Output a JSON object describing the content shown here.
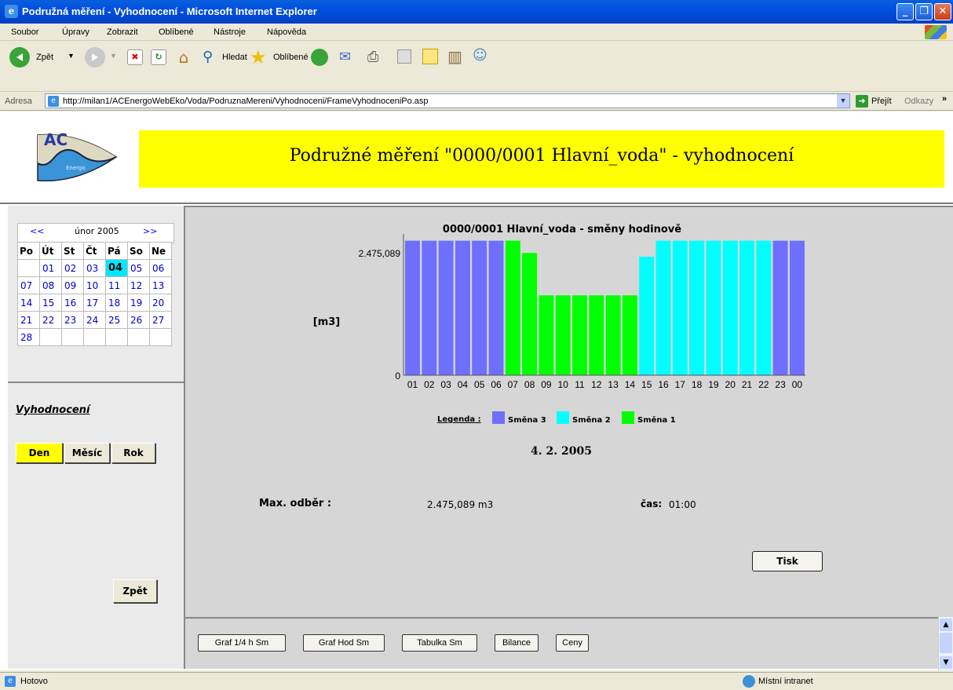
{
  "window": {
    "title": "Podružná měření - Vyhodnocení - Microsoft Internet Explorer"
  },
  "menu": {
    "items": [
      "Soubor",
      "Úpravy",
      "Zobrazit",
      "Oblíbené",
      "Nástroje",
      "Nápověda"
    ]
  },
  "toolbar": {
    "back_label": "Zpět",
    "search_label": "Hledat",
    "favorites_label": "Oblíbené"
  },
  "address": {
    "label": "Adresa",
    "url": "http://milan1/ACEnergoWebEko/Voda/PodruznaMereni/Vyhodnoceni/FrameVyhodnoceniPo.asp",
    "go_label": "Přejít",
    "links_label": "Odkazy"
  },
  "header": {
    "logo_text": "AC",
    "logo_subtext": "Energo",
    "title": "Podružné měření \"0000/0001 Hlavní_voda\" - vyhodnocení"
  },
  "calendar": {
    "prev": "<<",
    "next": ">>",
    "month": "únor 2005",
    "weekdays": [
      "Po",
      "Út",
      "St",
      "Čt",
      "Pá",
      "So",
      "Ne"
    ],
    "weeks": [
      [
        "",
        "01",
        "02",
        "03",
        "04",
        "05",
        "06"
      ],
      [
        "07",
        "08",
        "09",
        "10",
        "11",
        "12",
        "13"
      ],
      [
        "14",
        "15",
        "16",
        "17",
        "18",
        "19",
        "20"
      ],
      [
        "21",
        "22",
        "23",
        "24",
        "25",
        "26",
        "27"
      ],
      [
        "28",
        "",
        "",
        "",
        "",
        "",
        ""
      ]
    ],
    "selected": "04"
  },
  "left": {
    "section_title": "Vyhodnocení",
    "btn_day": "Den",
    "btn_month": "Měsíc",
    "btn_year": "Rok",
    "btn_back": "Zpět"
  },
  "chart_data": {
    "type": "bar",
    "title": "0000/0001 Hlavní_voda - směny hodinově",
    "ylabel": "[m3]",
    "y_ticks": [
      "2.475,089",
      "0"
    ],
    "ylim": [
      0,
      2.6
    ],
    "categories": [
      "01",
      "02",
      "03",
      "04",
      "05",
      "06",
      "07",
      "08",
      "09",
      "10",
      "11",
      "12",
      "13",
      "14",
      "15",
      "16",
      "17",
      "18",
      "19",
      "20",
      "21",
      "22",
      "23",
      "00"
    ],
    "values": [
      2.475,
      2.475,
      2.475,
      2.475,
      2.475,
      2.475,
      2.475,
      2.25,
      1.47,
      1.47,
      1.47,
      1.47,
      1.47,
      1.47,
      2.18,
      2.475,
      2.475,
      2.475,
      2.475,
      2.475,
      2.475,
      2.475,
      2.475,
      2.475
    ],
    "shifts": [
      3,
      3,
      3,
      3,
      3,
      3,
      1,
      1,
      1,
      1,
      1,
      1,
      1,
      1,
      2,
      2,
      2,
      2,
      2,
      2,
      2,
      2,
      3,
      3
    ],
    "series": [
      {
        "name": "Směna 3",
        "color": "#6e6eff"
      },
      {
        "name": "Směna 2",
        "color": "#00ffff"
      },
      {
        "name": "Směna 1",
        "color": "#00ff00"
      }
    ],
    "legend_label": "Legenda :"
  },
  "summary": {
    "date": "4. 2. 2005",
    "max_label": "Max. odběr :",
    "max_value": "2.475,089 m3",
    "time_label": "čas:",
    "time_value": "01:00",
    "print_label": "Tisk"
  },
  "bottom_buttons": [
    "Graf 1/4 h Sm",
    "Graf Hod Sm",
    "Tabulka Sm",
    "Bilance",
    "Ceny"
  ],
  "status": {
    "text": "Hotovo",
    "zone": "Místní intranet"
  },
  "colors": {
    "banner": "#ffff00",
    "calendar_selected": "#00e8ff",
    "den_button": "#ffff00"
  }
}
